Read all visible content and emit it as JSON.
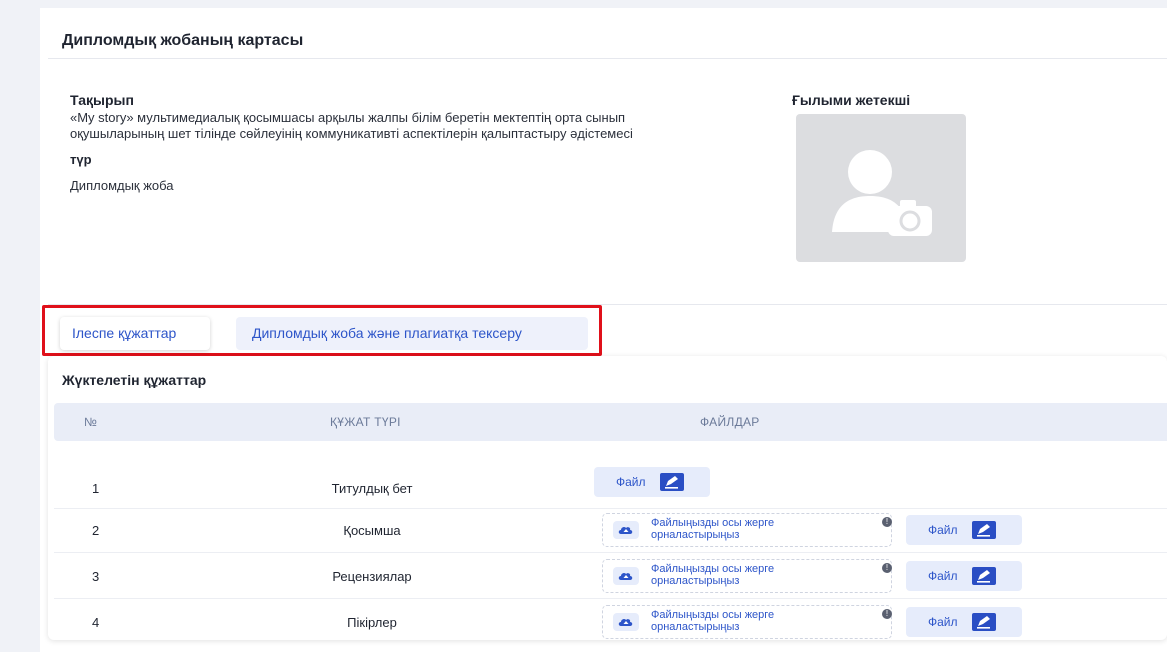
{
  "card": {
    "title": "Дипломдық жобаның картасы",
    "topic_label": "Тақырып",
    "topic_line1": "«My story» мультимедиалық қосымшасы арқылы жалпы білім беретін мектептің орта сынып",
    "topic_line2": "оқушыларының шет тілінде сөйлеуінің коммуникативті аспектілерін қалыптастыру әдістемесі",
    "type_label": "түр",
    "type_value": "Дипломдық жоба",
    "supervisor_label": "Ғылыми жетекші"
  },
  "tabs": [
    {
      "label": "Ілеспе құжаттар",
      "active": true
    },
    {
      "label": "Дипломдық жоба және плагиатқа тексеру",
      "active": false
    }
  ],
  "documents": {
    "title": "Жүктелетін құжаттар",
    "columns": {
      "num": "№",
      "type": "ҚҰЖАТ ТҮРІ",
      "files": "ФАЙЛДАР"
    },
    "file_button_label": "Файл",
    "dropzone_line1": "Файлыңызды осы жерге",
    "dropzone_line2": "орналастырыңыз",
    "info_glyph": "!",
    "rows": [
      {
        "num": "1",
        "type": "Титулдық бет"
      },
      {
        "num": "2",
        "type": "Қосымша"
      },
      {
        "num": "3",
        "type": "Рецензиялар"
      },
      {
        "num": "4",
        "type": "Пікірлер"
      }
    ]
  },
  "colors": {
    "accent": "#2d55c9",
    "highlight_border": "#e0101a",
    "header_bg": "#e9edf7"
  }
}
